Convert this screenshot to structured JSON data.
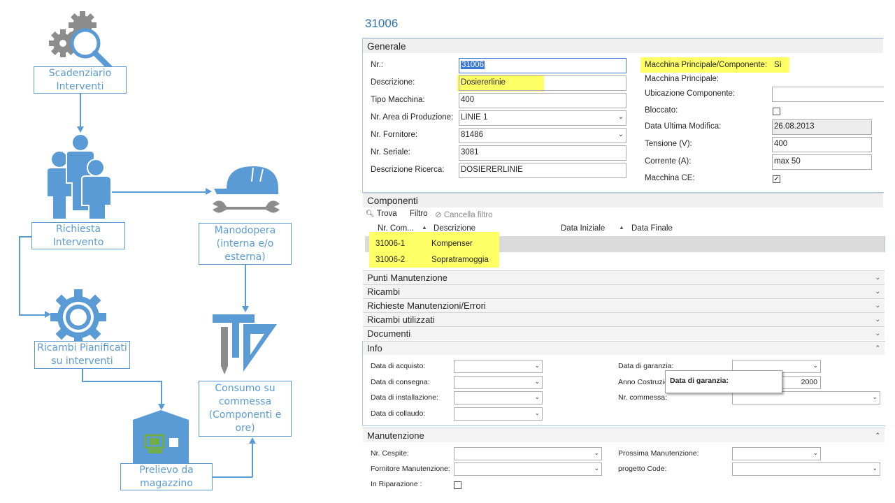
{
  "flow": {
    "scadenziario": "Scadenziario\nInterventi",
    "richiesta": "Richiesta\nIntervento",
    "manodopera": "Manodopera\n(interna e/o\nesterna)",
    "ricambi_pianificati": "Ricambi Pianificati\nsu interventi",
    "consumo": "Consumo su\ncommessa\n(Componenti e\nore)",
    "prelievo": "Prelievo da\nmagazzino",
    "colors": {
      "accent": "#5b9bd5",
      "device": "#70ad47"
    },
    "icons": [
      "gears-magnifier-icon",
      "people-group-icon",
      "hardhat-wrench-icon",
      "gear-icon",
      "pencil-ruler-triangle-icon",
      "warehouse-icon"
    ]
  },
  "record": {
    "title": "31006",
    "generale": {
      "header": "Generale",
      "nr_label": "Nr.:",
      "nr_value": "31006",
      "descrizione_label": "Descrizione:",
      "descrizione_value": "Dosiererlinie",
      "tipo_label": "Tipo Macchina:",
      "tipo_value": "400",
      "area_label": "Nr. Area di Produzione:",
      "area_value": "LINIE 1",
      "fornitore_label": "Nr. Fornitore:",
      "fornitore_value": "81486",
      "seriale_label": "Nr. Seriale:",
      "seriale_value": "3081",
      "ricerca_label": "Descrizione Ricerca:",
      "ricerca_value": "DOSIERERLINIE",
      "principale_comp_label": "Macchina Principale/Componente:",
      "principale_comp_value": "Sì",
      "principale_label": "Macchina Principale:",
      "ubicazione_label": "Ubicazione Componente:",
      "bloccato_label": "Bloccato:",
      "ultima_mod_label": "Data Ultima Modifica:",
      "ultima_mod_value": "26.08.2013",
      "tensione_label": "Tensione (V):",
      "tensione_value": "400",
      "corrente_label": "Corrente (A):",
      "corrente_value": "max 50",
      "ce_label": "Macchina CE:",
      "ce_checked": true
    },
    "componenti": {
      "header": "Componenti",
      "trova": "Trova",
      "filtro": "Filtro",
      "cancella": "Cancella filtro",
      "col_nr": "Nr. Com...",
      "col_desc": "Descrizione",
      "col_inizio": "Data Iniziale",
      "col_fine": "Data Finale",
      "rows": [
        {
          "nr": "31006-1",
          "desc": "Kompenser"
        },
        {
          "nr": "31006-2",
          "desc": "Sopratramoggia"
        }
      ]
    },
    "collapsed_sections": [
      "Punti Manutenzione",
      "Ricambi",
      "Richieste Manutenzioni/Errori",
      "Ricambi utilizzati",
      "Documenti"
    ],
    "info": {
      "header": "Info",
      "acquisto_label": "Data di acquisto:",
      "consegna_label": "Data di consegna:",
      "installazione_label": "Data di installazione:",
      "collaudo_label": "Data di collaudo:",
      "garanzia_label": "Data di garanzia:",
      "anno_label": "Anno Costruzio",
      "anno_value": "2000",
      "commessa_label": "Nr. commessa:",
      "tooltip": "Data di garanzia:"
    },
    "manutenzione": {
      "header": "Manutenzione",
      "cespite_label": "Nr. Cespite:",
      "fornitore_label": "Fornitore Manutenzione:",
      "riparazione_label": "In Riparazione :",
      "prossima_label": "Prossima Manutenzione:",
      "progetto_label": "progetto Code:"
    },
    "colors": {
      "title": "#2b74b5",
      "highlight": "#ffff66",
      "selection": "#3b78d8"
    }
  }
}
